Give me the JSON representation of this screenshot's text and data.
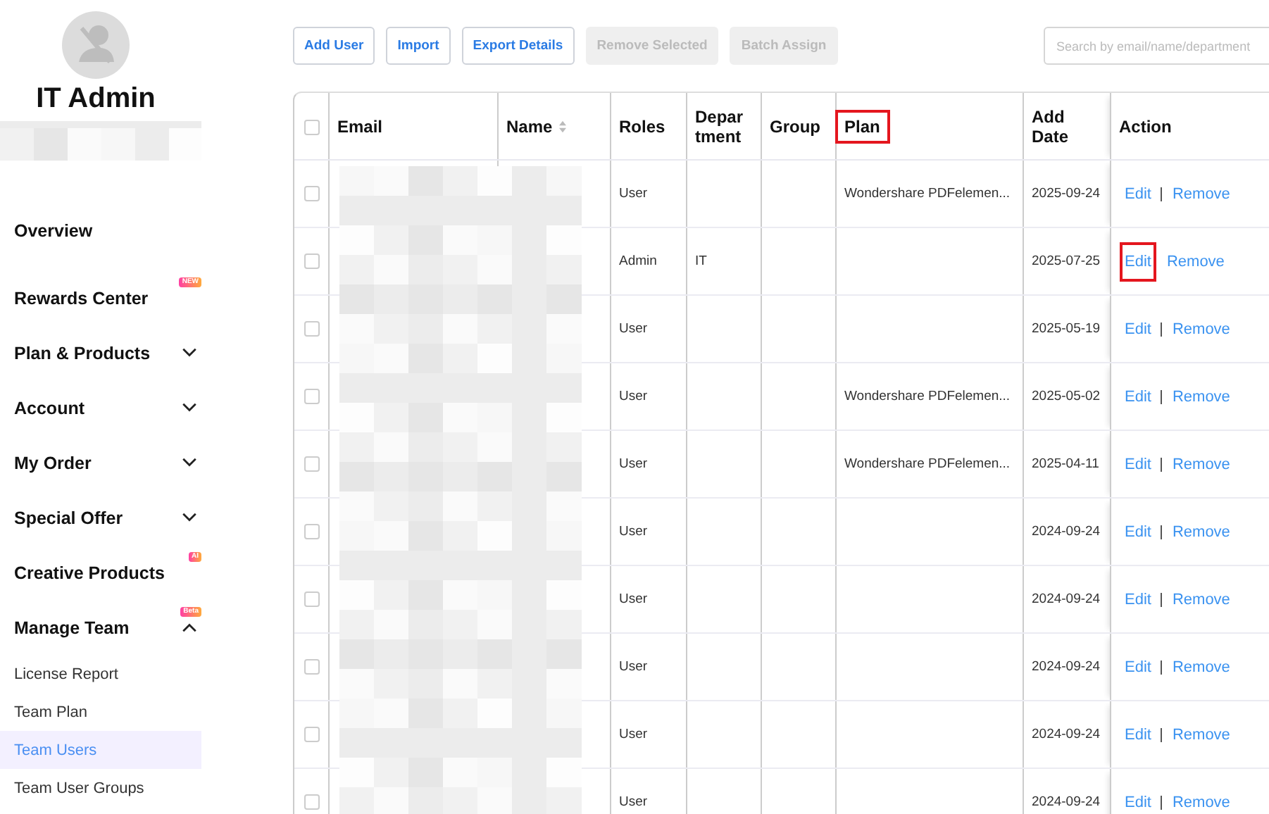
{
  "profile": {
    "name": "IT Admin"
  },
  "sidebar": {
    "items": [
      {
        "label": "Overview",
        "kind": "link"
      },
      {
        "label": "Rewards Center",
        "kind": "link",
        "badge": "NEW"
      },
      {
        "label": "Plan & Products",
        "kind": "group",
        "expanded": false
      },
      {
        "label": "Account",
        "kind": "group",
        "expanded": false
      },
      {
        "label": "My Order",
        "kind": "group",
        "expanded": false
      },
      {
        "label": "Special Offer",
        "kind": "group",
        "expanded": false
      },
      {
        "label": "Creative Products",
        "kind": "link",
        "badge": "AI"
      },
      {
        "label": "Manage Team",
        "kind": "group",
        "expanded": true,
        "badge": "Beta",
        "children": [
          {
            "label": "License Report",
            "selected": false
          },
          {
            "label": "Team Plan",
            "selected": false
          },
          {
            "label": "Team Users",
            "selected": true
          },
          {
            "label": "Team User Groups",
            "selected": false
          }
        ]
      }
    ]
  },
  "toolbar": {
    "buttons": [
      {
        "label": "Add User",
        "disabled": false
      },
      {
        "label": "Import",
        "disabled": false
      },
      {
        "label": "Export Details",
        "disabled": false
      },
      {
        "label": "Remove Selected",
        "disabled": true
      },
      {
        "label": "Batch Assign",
        "disabled": true
      }
    ],
    "search": {
      "placeholder": "Search by email/name/department"
    }
  },
  "table": {
    "select_all": {
      "checked": false
    },
    "columns": [
      {
        "label": "Email",
        "highlighted": false
      },
      {
        "label": "Name",
        "highlighted": false,
        "sortable": true
      },
      {
        "label": "Roles",
        "highlighted": false
      },
      {
        "label": "Depar tment",
        "highlighted": false
      },
      {
        "label": "Group",
        "highlighted": false
      },
      {
        "label": "Plan",
        "highlighted": true
      },
      {
        "label": "Add Date",
        "highlighted": false
      },
      {
        "label": "Action",
        "highlighted": false
      }
    ],
    "rows": [
      {
        "checked": false,
        "role": "User",
        "department": "",
        "plan": "Wondershare PDFelemen...",
        "date": "2025-09-24",
        "edit": "Edit",
        "remove": "Remove",
        "edit_highlighted": false
      },
      {
        "checked": false,
        "role": "Admin",
        "department": "IT",
        "plan": "",
        "date": "2025-07-25",
        "edit": "Edit",
        "remove": "Remove",
        "edit_highlighted": true
      },
      {
        "checked": false,
        "role": "User",
        "department": "",
        "plan": "",
        "date": "2025-05-19",
        "edit": "Edit",
        "remove": "Remove",
        "edit_highlighted": false
      },
      {
        "checked": false,
        "role": "User",
        "department": "",
        "plan": "Wondershare PDFelemen...",
        "date": "2025-05-02",
        "edit": "Edit",
        "remove": "Remove",
        "edit_highlighted": false
      },
      {
        "checked": false,
        "role": "User",
        "department": "",
        "plan": "Wondershare PDFelemen...",
        "date": "2025-04-11",
        "edit": "Edit",
        "remove": "Remove",
        "edit_highlighted": false
      },
      {
        "checked": false,
        "role": "User",
        "department": "",
        "plan": "",
        "date": "2024-09-24",
        "edit": "Edit",
        "remove": "Remove",
        "edit_highlighted": false
      },
      {
        "checked": false,
        "role": "User",
        "department": "",
        "plan": "",
        "date": "2024-09-24",
        "edit": "Edit",
        "remove": "Remove",
        "edit_highlighted": false
      },
      {
        "checked": false,
        "role": "User",
        "department": "",
        "plan": "",
        "date": "2024-09-24",
        "edit": "Edit",
        "remove": "Remove",
        "edit_highlighted": false
      },
      {
        "checked": false,
        "role": "User",
        "department": "",
        "plan": "",
        "date": "2024-09-24",
        "edit": "Edit",
        "remove": "Remove",
        "edit_highlighted": false
      },
      {
        "checked": false,
        "role": "User",
        "department": "",
        "plan": "",
        "date": "2024-09-24",
        "edit": "Edit",
        "remove": "Remove",
        "edit_highlighted": false
      }
    ]
  }
}
